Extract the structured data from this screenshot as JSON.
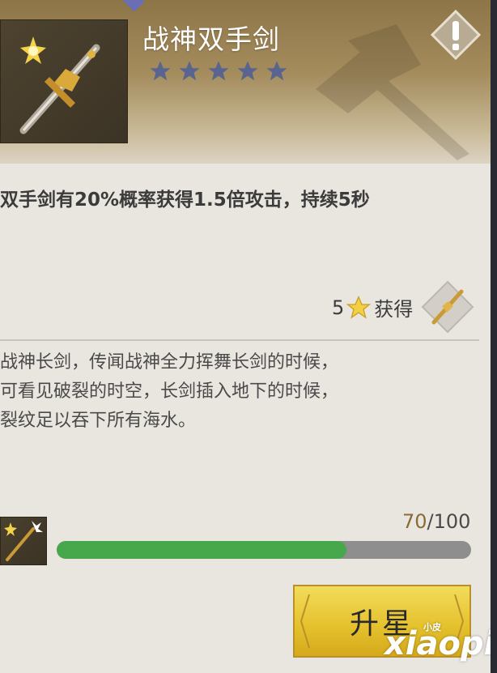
{
  "item": {
    "name": "战神双手剑",
    "rarity_stars": 5,
    "effect": "双手剑有20%概率获得1.5倍攻击，持续5秒",
    "obtain": {
      "count": "5",
      "label": "获得"
    },
    "lore": [
      "战神长剑，传闻战神全力挥舞长剑的时候，",
      "可看见破裂的时空，长剑插入地下的时候，",
      "裂纹足以吞下所有海水。"
    ]
  },
  "progress": {
    "current": "70",
    "separator": "/",
    "max": "100",
    "fraction": 0.7
  },
  "buttons": {
    "star_up": "升星"
  },
  "watermark": {
    "text": "xiaopi",
    "small": "小皮"
  },
  "colors": {
    "accent_gold": "#e4c02c",
    "progress_green": "#46a84a",
    "star_blue": "#5a6491"
  },
  "icons": [
    "sword-portrait-icon",
    "star-icon",
    "alert-icon",
    "axe-watermark-icon"
  ]
}
